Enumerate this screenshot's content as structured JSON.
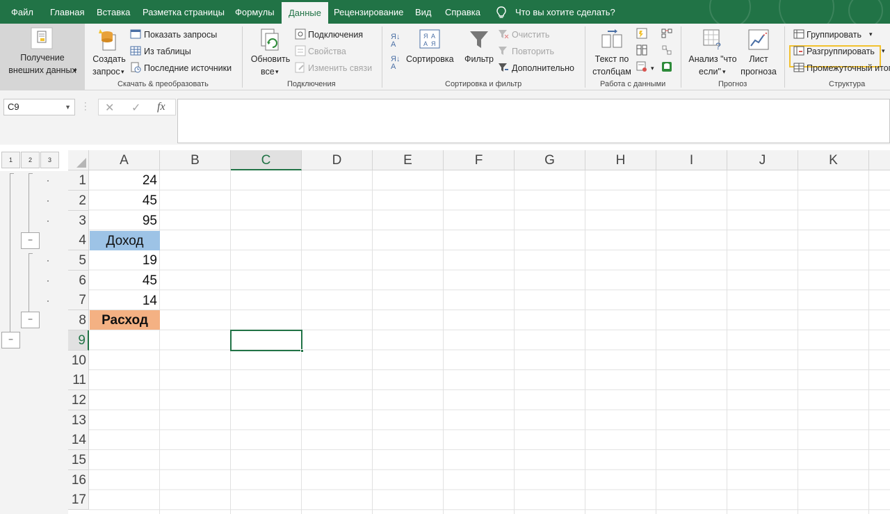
{
  "tabs": [
    "Файл",
    "Главная",
    "Вставка",
    "Разметка страницы",
    "Формулы",
    "Данные",
    "Рецензирование",
    "Вид",
    "Справка"
  ],
  "active_tab": "Данные",
  "tell_me": "Что вы хотите сделать?",
  "ribbon": {
    "get_data": {
      "line1": "Получение",
      "line2": "внешних данных"
    },
    "transform": {
      "create_query_l1": "Создать",
      "create_query_l2": "запрос",
      "show_queries": "Показать запросы",
      "from_table": "Из таблицы",
      "recent_sources": "Последние источники",
      "group_label": "Скачать & преобразовать"
    },
    "connections": {
      "refresh_l1": "Обновить",
      "refresh_l2": "все",
      "connections": "Подключения",
      "properties": "Свойства",
      "edit_links": "Изменить связи",
      "group_label": "Подключения"
    },
    "sort_filter": {
      "sort": "Сортировка",
      "filter": "Фильтр",
      "clear": "Очистить",
      "reapply": "Повторить",
      "advanced": "Дополнительно",
      "group_label": "Сортировка и фильтр"
    },
    "data_tools": {
      "text_to_columns_l1": "Текст по",
      "text_to_columns_l2": "столбцам",
      "group_label": "Работа с данными"
    },
    "forecast": {
      "whatif_l1": "Анализ \"что",
      "whatif_l2": "если\"",
      "sheet_l1": "Лист",
      "sheet_l2": "прогноза",
      "group_label": "Прогноз"
    },
    "outline": {
      "group": "Группировать",
      "ungroup": "Разгруппировать",
      "subtotal": "Промежуточный итог",
      "group_label": "Структура"
    }
  },
  "formula_bar": {
    "name_box": "C9",
    "cancel_icon": "✕",
    "enter_icon": "✓",
    "fx": "fx",
    "formula": ""
  },
  "outline_levels": [
    "1",
    "2",
    "3"
  ],
  "outline_buttons": [
    "−",
    "−",
    "−"
  ],
  "columns": [
    "A",
    "B",
    "C",
    "D",
    "E",
    "F",
    "G",
    "H",
    "I",
    "J",
    "K"
  ],
  "rows": [
    "1",
    "2",
    "3",
    "4",
    "5",
    "6",
    "7",
    "8",
    "9",
    "10",
    "11",
    "12",
    "13",
    "14",
    "15",
    "16",
    "17"
  ],
  "cells": {
    "A1": "24",
    "A2": "45",
    "A3": "95",
    "A4": "Доход",
    "A5": "19",
    "A6": "45",
    "A7": "14",
    "A8": "Расход"
  },
  "colors": {
    "accent": "#217346",
    "income_fill": "#9dc3e6",
    "expense_fill": "#f4b183",
    "highlight": "#f2c12e"
  },
  "selected_cell": "C9"
}
